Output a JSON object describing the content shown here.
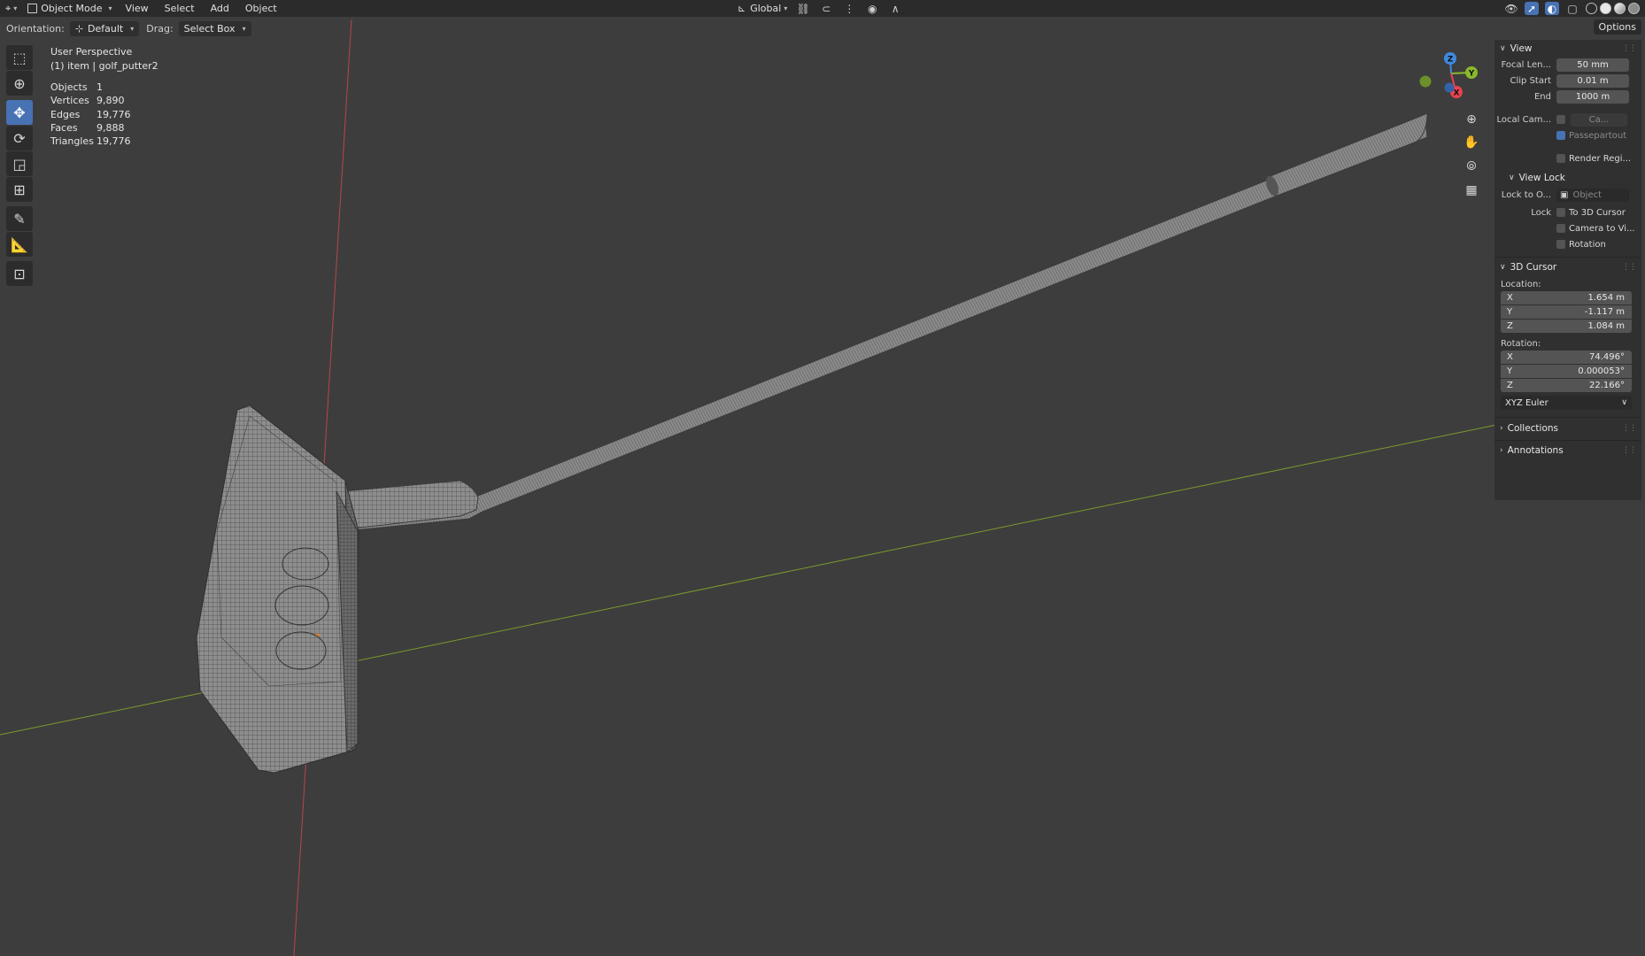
{
  "header": {
    "editor_icon": "3d-viewport-icon",
    "mode": "Object Mode",
    "menus": [
      "View",
      "Select",
      "Add",
      "Object"
    ],
    "transform_orientation": "Global"
  },
  "tool_settings": {
    "orientation_label": "Orientation:",
    "orientation_value": "Default",
    "drag_label": "Drag:",
    "drag_value": "Select Box",
    "options_label": "Options"
  },
  "left_tools": [
    "select-box-icon",
    "cursor-icon",
    "move-icon",
    "rotate-icon",
    "scale-icon",
    "transform-icon",
    "annotate-icon",
    "measure-icon",
    "add-cube-icon"
  ],
  "viewport": {
    "view_name": "User Perspective",
    "object_info": "(1) item | golf_putter2",
    "stats": [
      {
        "label": "Objects",
        "value": "1"
      },
      {
        "label": "Vertices",
        "value": "9,890"
      },
      {
        "label": "Edges",
        "value": "19,776"
      },
      {
        "label": "Faces",
        "value": "9,888"
      },
      {
        "label": "Triangles",
        "value": "19,776"
      }
    ],
    "gizmo": {
      "x": "X",
      "y": "Y",
      "z": "Z",
      "x_color": "#e8434f",
      "y_color": "#8ab82c",
      "z_color": "#3f8ae0"
    }
  },
  "npanel": {
    "view": {
      "title": "View",
      "focal_label": "Focal Len...",
      "focal_value": "50 mm",
      "clip_start_label": "Clip Start",
      "clip_start_value": "0.01 m",
      "end_label": "End",
      "end_value": "1000 m",
      "local_cam_label": "Local Cam...",
      "local_cam_value": "Ca...",
      "passepartout": "Passepartout",
      "render_region": "Render Regi..."
    },
    "view_lock": {
      "title": "View Lock",
      "lock_to_label": "Lock to O...",
      "lock_to_value": "Object",
      "lock_label": "Lock",
      "to_cursor": "To 3D Cursor",
      "camera_to_view": "Camera to Vi...",
      "rotation": "Rotation"
    },
    "cursor": {
      "title": "3D Cursor",
      "location_label": "Location:",
      "location": [
        {
          "axis": "X",
          "value": "1.654 m"
        },
        {
          "axis": "Y",
          "value": "-1.117 m"
        },
        {
          "axis": "Z",
          "value": "1.084 m"
        }
      ],
      "rotation_label": "Rotation:",
      "rotation": [
        {
          "axis": "X",
          "value": "74.496°"
        },
        {
          "axis": "Y",
          "value": "0.000053°"
        },
        {
          "axis": "Z",
          "value": "22.166°"
        }
      ],
      "rotation_mode": "XYZ Euler"
    },
    "collections": "Collections",
    "annotations": "Annotations"
  },
  "colors": {
    "accent": "#4772b3",
    "viewport_bg": "#3d3d3d",
    "x_axis": "#b5474c",
    "y_axis": "#7b9a2c"
  }
}
